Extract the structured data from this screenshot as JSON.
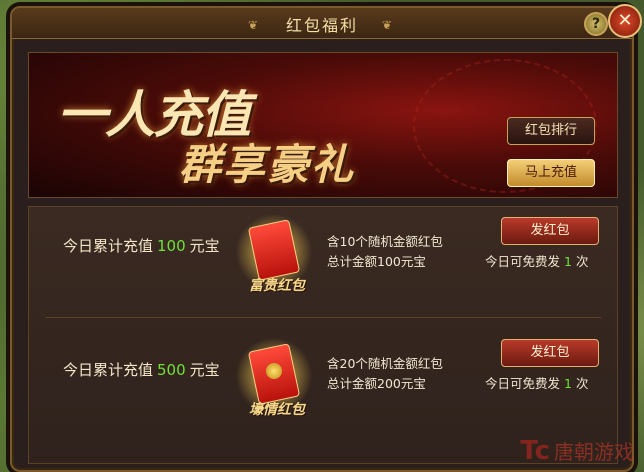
{
  "window": {
    "title": "红包福利",
    "help_label": "?",
    "close_label": "✕"
  },
  "banner": {
    "line1": "一人充值",
    "line2": "群享豪礼",
    "ranking_button": "红包排行",
    "recharge_button": "马上充值"
  },
  "rewards": [
    {
      "prefix": "今日累计充值",
      "amount": "100",
      "unit": "元宝",
      "envelope_caption": "富贵红包",
      "desc_line1": "含10个随机金额红包",
      "desc_line2": "总计金额100元宝",
      "send_button": "发红包",
      "free_prefix": "今日可免费发",
      "free_count": "1",
      "free_unit": "次"
    },
    {
      "prefix": "今日累计充值",
      "amount": "500",
      "unit": "元宝",
      "envelope_caption": "壕情红包",
      "desc_line1": "含20个随机金额红包",
      "desc_line2": "总计金额200元宝",
      "send_button": "发红包",
      "free_prefix": "今日可免费发",
      "free_count": "1",
      "free_unit": "次"
    }
  ],
  "watermark": {
    "logo": "Tc",
    "text": "唐朝游戏"
  },
  "colors": {
    "accent_gold": "#c9a25a",
    "highlight_green": "#6fe03a",
    "banner_red": "#8a1410"
  }
}
